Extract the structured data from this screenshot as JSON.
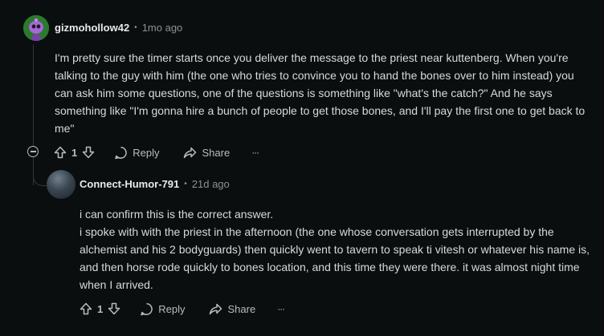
{
  "comment1": {
    "username": "gizmohollow42",
    "separator": "•",
    "age": "1mo ago",
    "body": "I'm pretty sure the timer starts once you deliver the message to the priest near kuttenberg. When you're talking to the guy with him (the one who tries to convince you to hand the bones over to him instead) you can ask him some questions, one of the questions is something like \"what's the catch?\" And he says something like \"I'm gonna hire a bunch of people to get those bones, and I'll pay the first one to get back to me\"",
    "votes": "1",
    "reply_label": "Reply",
    "share_label": "Share",
    "more_label": "···"
  },
  "comment2": {
    "username": "Connect-Humor-791",
    "separator": "•",
    "age": "21d ago",
    "body_line1": "i can confirm this is the correct answer.",
    "body_line2": "i spoke with with the priest in the afternoon (the one whose conversation gets interrupted by the alchemist and his 2 bodyguards) then quickly went to tavern to speak ti vitesh or whatever his name is, and then horse rode quickly to bones location, and this time they were there. it was almost night time when I arrived.",
    "votes": "1",
    "reply_label": "Reply",
    "share_label": "Share",
    "more_label": "···"
  },
  "icons": {
    "upvote": "upvote-icon",
    "downvote": "downvote-icon",
    "reply": "reply-icon",
    "share": "share-icon",
    "more": "more-icon",
    "collapse": "collapse-icon"
  },
  "colors": {
    "background": "#0b0e0f",
    "text": "#d7dadc",
    "muted": "#8b9094",
    "thread_line": "#343536",
    "avatar1_bg": "#2b7a2f"
  }
}
